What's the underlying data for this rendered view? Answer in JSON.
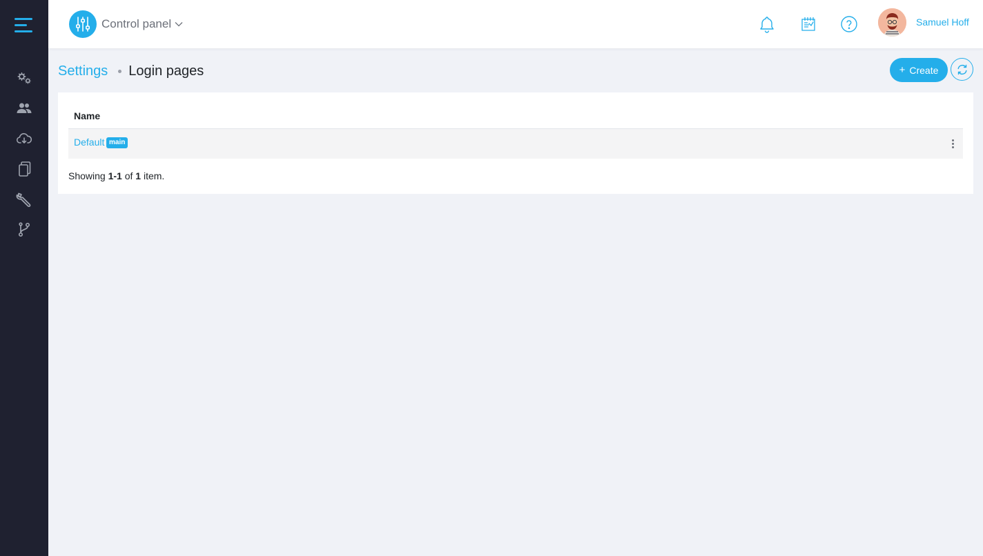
{
  "header": {
    "panel_label": "Control panel",
    "user_name": "Samuel Hoff",
    "icons": [
      "bell-icon",
      "clipboard-icon",
      "help-icon"
    ]
  },
  "sidebar": {
    "items": [
      {
        "icon": "gears-icon"
      },
      {
        "icon": "users-icon"
      },
      {
        "icon": "cloud-download-icon"
      },
      {
        "icon": "documents-icon"
      },
      {
        "icon": "wrench-icon"
      },
      {
        "icon": "git-branch-icon"
      }
    ]
  },
  "breadcrumb": {
    "parent": "Settings",
    "current": "Login pages"
  },
  "actions": {
    "create_label": "Create",
    "create_icon": "+"
  },
  "table": {
    "column_name": "Name",
    "rows": [
      {
        "name": "Default",
        "badge": "main"
      }
    ]
  },
  "summary": {
    "prefix": "Showing",
    "range": "1-1",
    "of": "of",
    "total": "1",
    "suffix": "item."
  },
  "colors": {
    "accent": "#24aeea",
    "sidebar_bg": "#1f2130",
    "page_bg": "#f0f2f7"
  }
}
